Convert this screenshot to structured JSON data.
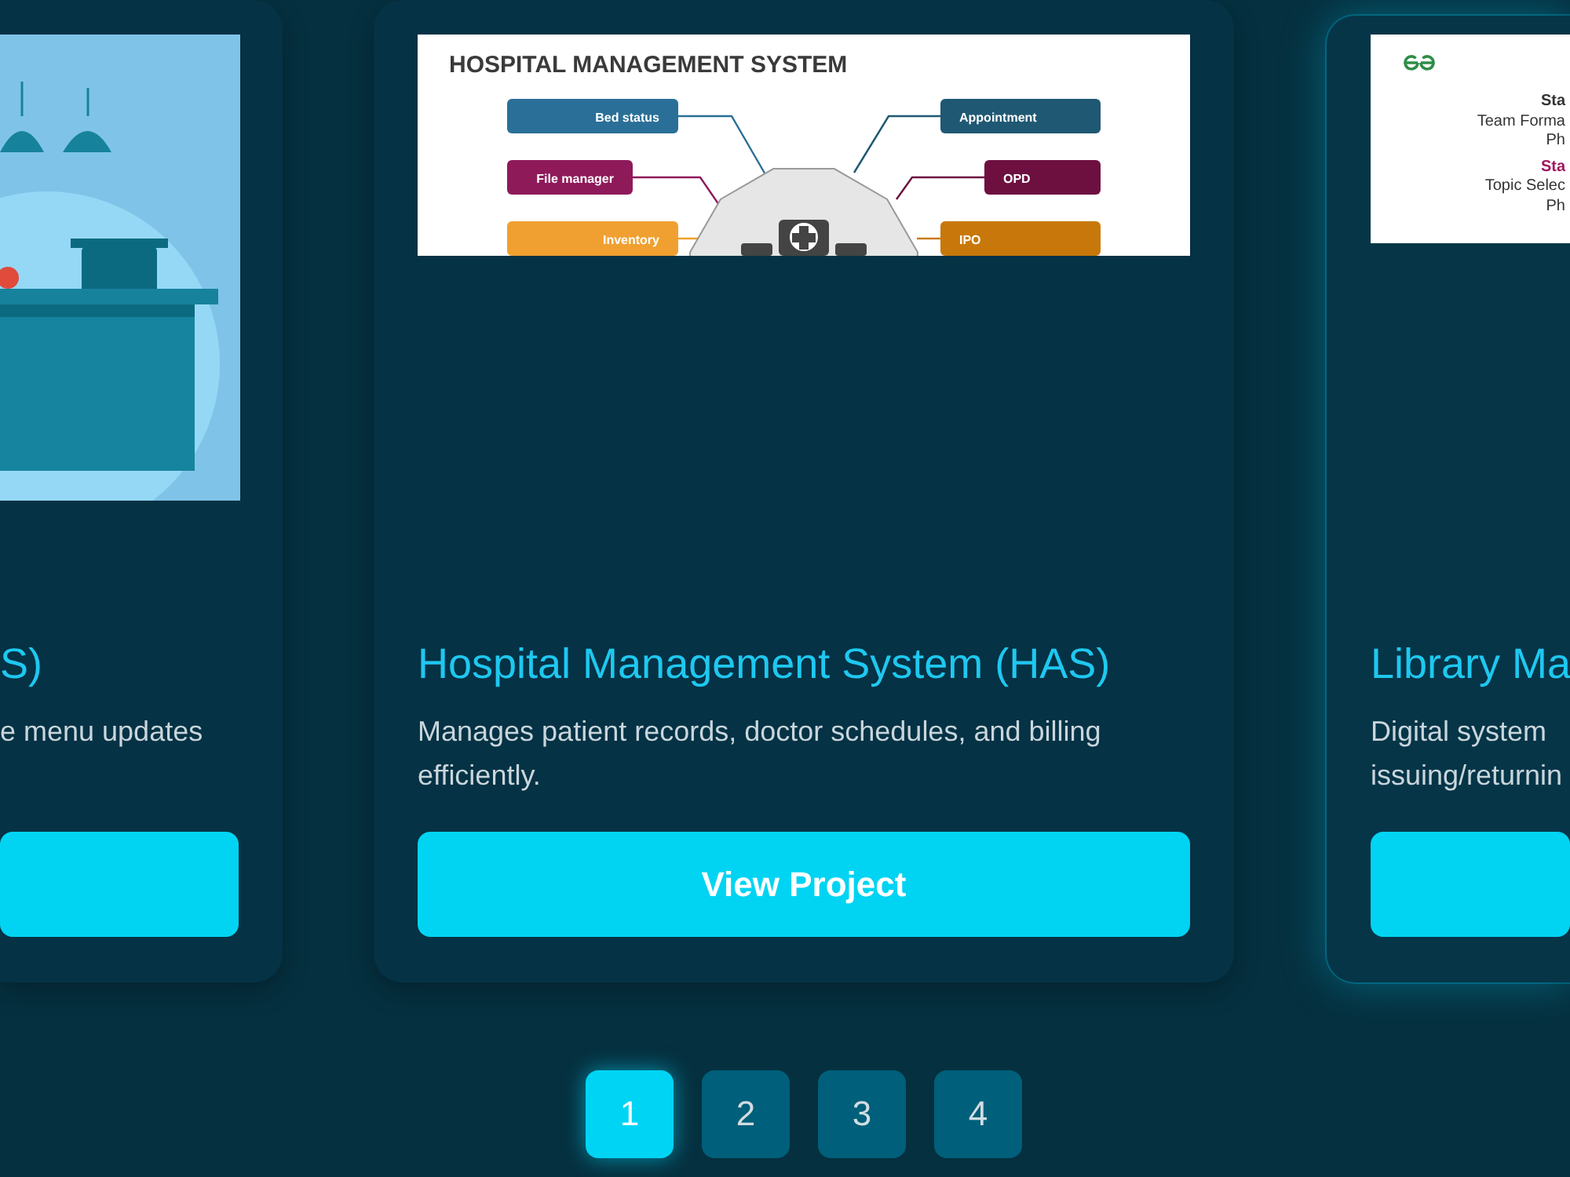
{
  "cards": [
    {
      "highlighted": false,
      "media": {
        "kind": "picture"
      },
      "title": "S)",
      "description": [
        "e menu updates"
      ]
    },
    {
      "highlighted": false,
      "media": {
        "kind": "diagram",
        "title": "HOSPITAL MANAGEMENT SYSTEM",
        "nodes": [
          {
            "label": "Bed status",
            "color": "#2a6f97"
          },
          {
            "label": "Appointment",
            "color": "#1f5873"
          },
          {
            "label": "File manager",
            "color": "#8e1a5a"
          },
          {
            "label": "OPD",
            "color": "#6d1040"
          },
          {
            "label": "Inventory",
            "color": "#f0a030"
          },
          {
            "label": "IPO",
            "color": "#c8780a"
          }
        ]
      },
      "title": "Hospital Management System (HAS)",
      "description": [
        "Manages patient records, doctor schedules, and billing",
        "efficiently."
      ],
      "button": "View Project"
    },
    {
      "highlighted": true,
      "media": {
        "kind": "slide",
        "lines": [
          {
            "text": "Sta",
            "kind": "heading"
          },
          {
            "text": "Team Forma",
            "kind": "text"
          },
          {
            "text": "Ph",
            "kind": "text"
          },
          {
            "text": "Sta",
            "kind": "accent-heading"
          },
          {
            "text": "Topic Selec",
            "kind": "text"
          },
          {
            "text": "Ph",
            "kind": "text"
          }
        ]
      },
      "title": "Library Ma",
      "description": [
        "Digital system",
        "issuing/returnin"
      ]
    }
  ],
  "pages": [
    {
      "label": "1",
      "selected": true
    },
    {
      "label": "2",
      "selected": false
    },
    {
      "label": "3",
      "selected": false
    },
    {
      "label": "4",
      "selected": false
    }
  ]
}
